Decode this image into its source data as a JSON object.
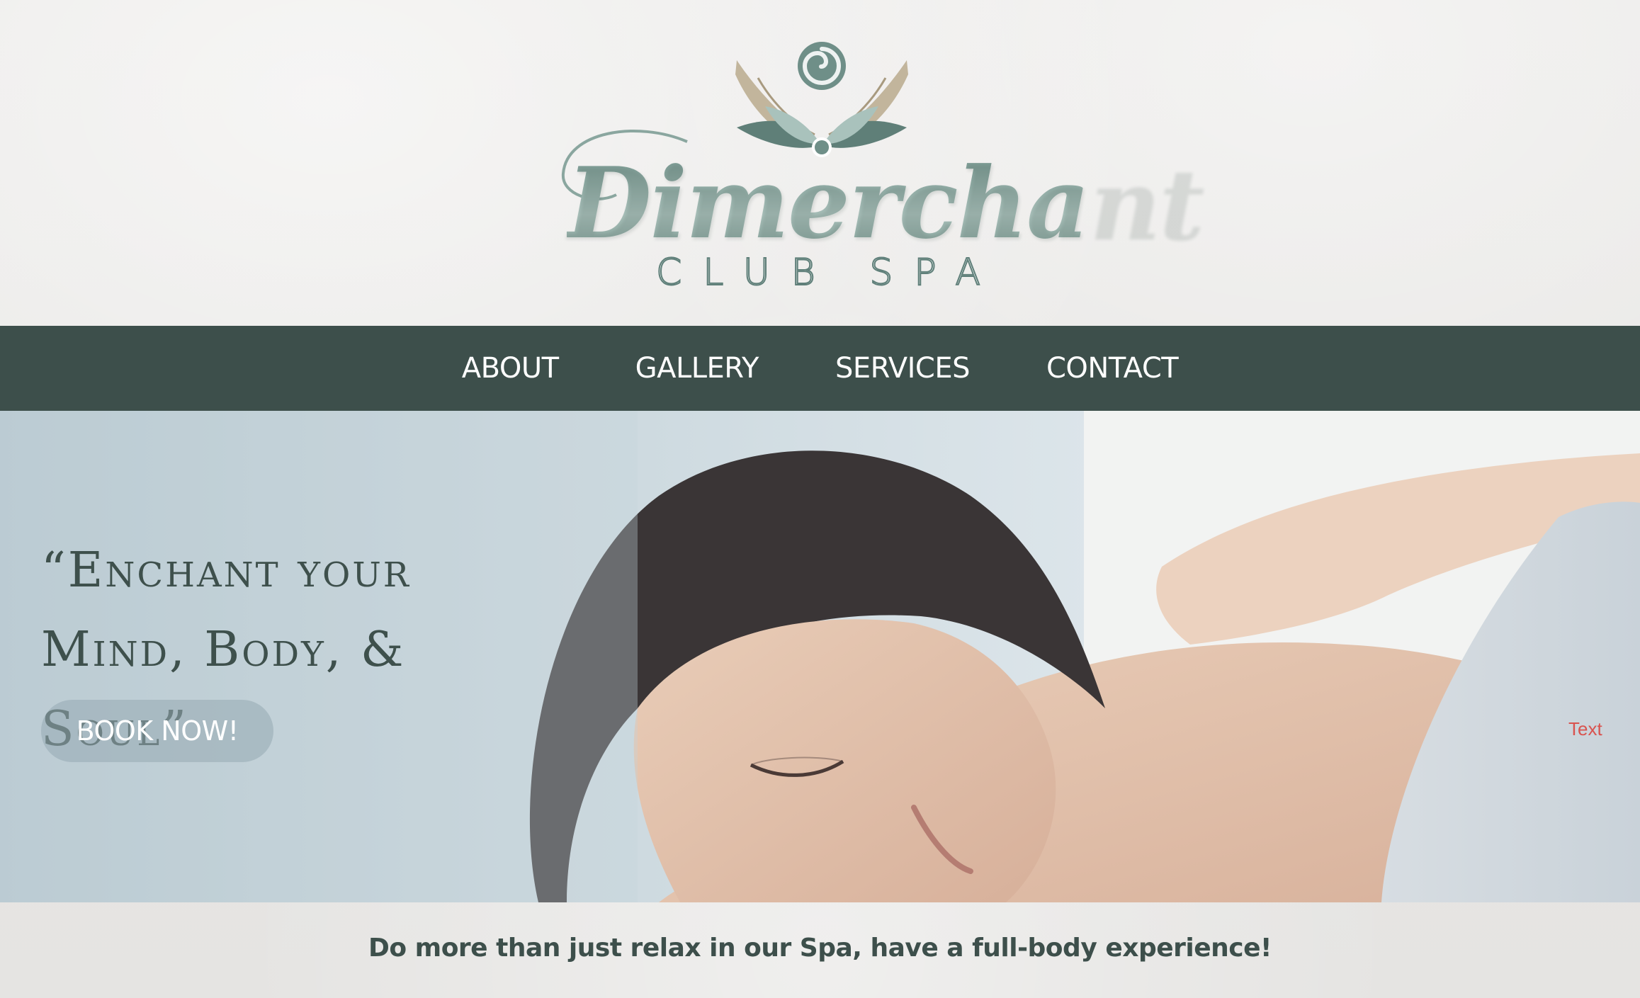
{
  "brand": {
    "name": "Dimerchant",
    "subtitle": "CLUB SPA"
  },
  "nav": {
    "items": [
      {
        "label": "ABOUT"
      },
      {
        "label": "GALLERY"
      },
      {
        "label": "SERVICES"
      },
      {
        "label": "CONTACT"
      }
    ]
  },
  "hero": {
    "headline_line1": "“Enchant your",
    "headline_line2": "Mind, Body, & Soul”",
    "cta_label": "BOOK NOW!",
    "stray_label": "Text"
  },
  "tagline": "Do more than just relax in our Spa, have a full-body experience!",
  "colors": {
    "nav_bg": "#3d4f4b",
    "logo_green": "#7f9e96",
    "logo_tan": "#bfb39a",
    "heading_text": "#3e504c",
    "stray_text": "#d9534f"
  },
  "icons": {
    "logo_mark": "lotus-hands-spiral-icon"
  }
}
